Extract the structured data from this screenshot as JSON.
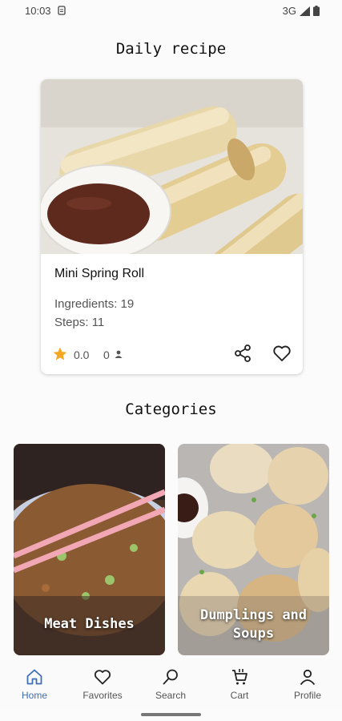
{
  "status_bar": {
    "time": "10:03",
    "network": "3G"
  },
  "daily": {
    "title": "Daily recipe",
    "recipe": {
      "name": "Mini Spring Roll",
      "ingredients": "Ingredients: 19",
      "steps": "Steps: 11",
      "rating": "0.0",
      "reviews": "0"
    }
  },
  "categories": {
    "title": "Categories",
    "items": [
      {
        "label": "Meat Dishes"
      },
      {
        "label": "Dumplings and Soups"
      }
    ]
  },
  "nav": {
    "items": [
      {
        "label": "Home",
        "icon": "home-icon",
        "active": true
      },
      {
        "label": "Favorites",
        "icon": "heart-icon",
        "active": false
      },
      {
        "label": "Search",
        "icon": "search-icon",
        "active": false
      },
      {
        "label": "Cart",
        "icon": "cart-icon",
        "active": false
      },
      {
        "label": "Profile",
        "icon": "person-icon",
        "active": false
      }
    ]
  },
  "colors": {
    "accent": "#3f6fb5",
    "star": "#f5a623"
  }
}
